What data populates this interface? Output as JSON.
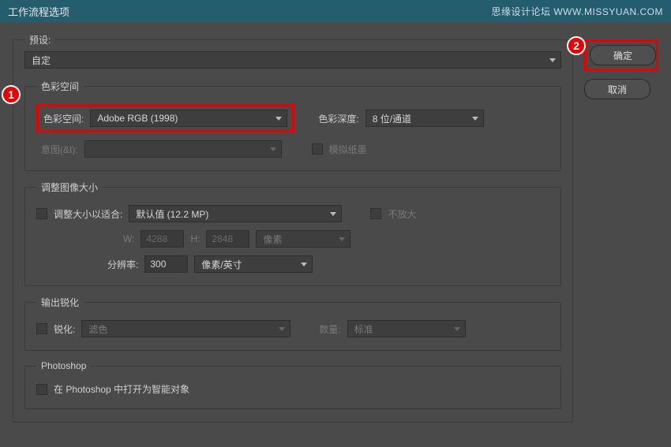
{
  "titlebar": {
    "title": "工作流程选项",
    "watermark": "思缘设计论坛  WWW.MISSYUAN.COM"
  },
  "preset": {
    "label": "预设:",
    "value": "自定"
  },
  "groups": {
    "colorSpace": {
      "legend": "色彩空间",
      "spaceLabel": "色彩空间:",
      "spaceValue": "Adobe RGB (1998)",
      "depthLabel": "色彩深度:",
      "depthValue": "8 位/通道",
      "intentLabel": "意图(&I):",
      "intentValue": "",
      "simPaperLabel": "模拟纸墨"
    },
    "resize": {
      "legend": "调整图像大小",
      "fitLabel": "调整大小以适合:",
      "fitValue": "默认值 (12.2 MP)",
      "noEnlargeLabel": "不放大",
      "wLabel": "W:",
      "wValue": "4288",
      "hLabel": "H:",
      "hValue": "2848",
      "unitsValue": "像素",
      "resLabel": "分辨率:",
      "resValue": "300",
      "resUnits": "像素/英寸"
    },
    "sharpen": {
      "legend": "输出锐化",
      "sharpenLabel": "锐化:",
      "sharpenValue": "滤色",
      "amountLabel": "数量:",
      "amountValue": "标准"
    },
    "ps": {
      "legend": "Photoshop",
      "smartObjectLabel": "在 Photoshop 中打开为智能对象"
    }
  },
  "buttons": {
    "ok": "确定",
    "cancel": "取消"
  },
  "annotations": {
    "b1": "1",
    "b2": "2"
  }
}
